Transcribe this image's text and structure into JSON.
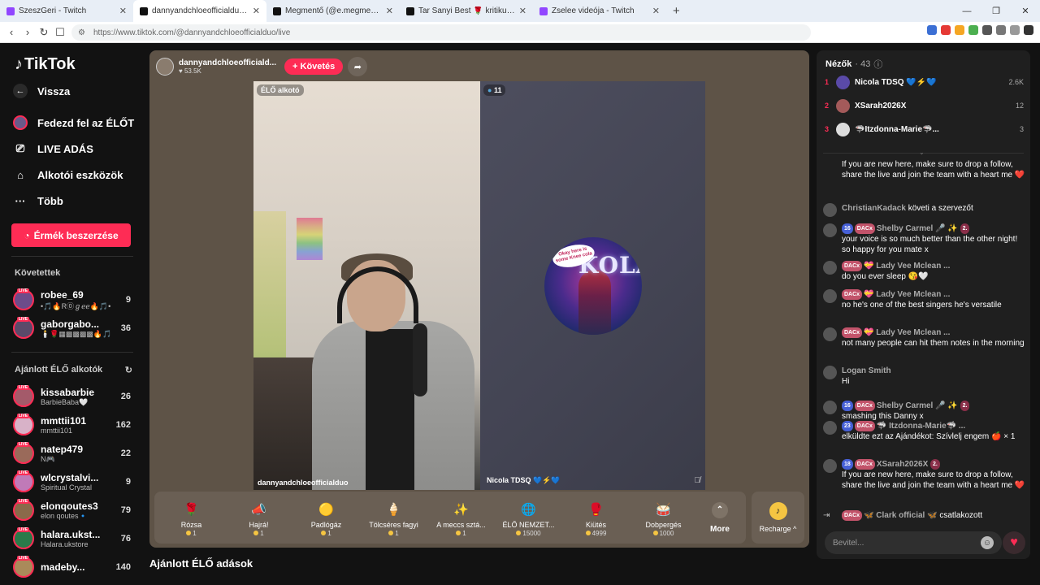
{
  "browser": {
    "tabs": [
      {
        "title": "SzeszGeri - Twitch",
        "color": "#9146ff",
        "active": false
      },
      {
        "title": "dannyandchloeofficialduo (@dan",
        "color": "#111111",
        "active": true
      },
      {
        "title": "Megmentő (@e.megmento) ÉLŐ adás",
        "color": "#111111",
        "active": false
      },
      {
        "title": "Tar Sanyi Best 🌹 kritikus 🧱 (@szop",
        "color": "#111111",
        "active": false
      },
      {
        "title": "Zselee videója - Twitch",
        "color": "#9146ff",
        "active": false
      }
    ],
    "url": "https://www.tiktok.com/@dannyandchloeofficialduo/live"
  },
  "sidebar": {
    "logo": "TikTok",
    "back": "Vissza",
    "nav": [
      {
        "label": "Fedezd fel az ÉLŐT",
        "icon": "avatar-icon"
      },
      {
        "label": "LIVE ADÁS",
        "icon": "camera-icon"
      },
      {
        "label": "Alkotói eszközök",
        "icon": "home-tools-icon"
      },
      {
        "label": "Több",
        "icon": "more-icon"
      }
    ],
    "buy_coins": "Érmék beszerzése",
    "following_title": "Követettek",
    "following": [
      {
        "name": "robee_69",
        "sub": "•🎵🔥R⓪ℊℯℯ🔥🎵•",
        "count": "9",
        "color": "#6d4c8a"
      },
      {
        "name": "gaborgabo...",
        "sub": "🕯️🌹▦▩▩▩▩🔥🎵",
        "count": "36",
        "color": "#5b4a6a"
      }
    ],
    "recommended_title": "Ajánlott ÉLŐ alkotók",
    "recommended": [
      {
        "name": "kissabarbie",
        "sub": "BarbieBaba🤍",
        "count": "26",
        "color": "#a45a6a"
      },
      {
        "name": "mmttii101",
        "sub": "mmttii101",
        "count": "162",
        "color": "#d8b2c8"
      },
      {
        "name": "natep479",
        "sub": "N🎮",
        "count": "22",
        "color": "#9a6a5a"
      },
      {
        "name": "wlcrystalvi...",
        "sub": "Spiritual Crystal",
        "count": "9",
        "color": "#c07ab8"
      },
      {
        "name": "elonqoutes3",
        "sub": "elon qoutes🔹",
        "count": "79",
        "color": "#8a6a4a"
      },
      {
        "name": "halara.ukst...",
        "sub": "Halara.ukstore",
        "count": "76",
        "color": "#2a7a4a"
      },
      {
        "name": "madeby...",
        "sub": "",
        "count": "140",
        "color": "#aa8a5a"
      }
    ]
  },
  "stream": {
    "host_name": "dannyandchloeofficiald...",
    "likes": "53.5K",
    "follow": "+ Követés",
    "left_label": "ÉLŐ alkotó",
    "right_count": "11",
    "left_name": "dannyandchloeofficialduo",
    "right_name": "Nicola TDSQ 💙⚡💙",
    "bubble": "Okay here is some Knee cola",
    "cola": "KOLA",
    "gifts": [
      {
        "name": "Rózsa",
        "price": "1",
        "icon": "🌹",
        "bg": "#6a5f54"
      },
      {
        "name": "Hajrá!",
        "price": "1",
        "icon": "📣",
        "bg": "#6a5f54"
      },
      {
        "name": "Padlógáz",
        "price": "1",
        "icon": "🟡",
        "bg": "#6a5f54"
      },
      {
        "name": "Tölcséres fagyi",
        "price": "1",
        "icon": "🍦",
        "bg": "#6a5f54"
      },
      {
        "name": "A meccs sztá...",
        "price": "1",
        "icon": "✨",
        "bg": "#6a5f54"
      },
      {
        "name": "ÉLŐ NEMZET...",
        "price": "15000",
        "icon": "🌐",
        "bg": "#6a5f54"
      },
      {
        "name": "Kiütés",
        "price": "4999",
        "icon": "🥊",
        "bg": "#6a5f54"
      },
      {
        "name": "Dobpergés",
        "price": "1000",
        "icon": "🥁",
        "bg": "#6a5f54"
      }
    ],
    "more": "More",
    "recharge": "Recharge ^",
    "recommended_title": "Ajánlott ÉLŐ adások"
  },
  "chat": {
    "viewers_title": "Nézők",
    "viewers_count": "· 43",
    "viewers": [
      {
        "rank": "1",
        "name": "Nicola TDSQ 💙⚡💙",
        "score": "2.6K",
        "color": "#5a4aa8"
      },
      {
        "rank": "2",
        "name": "XSarah2026X",
        "score": "12",
        "color": "#a45a5a"
      },
      {
        "rank": "3",
        "name": "🦈Itzdonna-Marie🦈...",
        "score": "3",
        "color": "#dddddd"
      }
    ],
    "messages": [
      {
        "text": "If you are new here, make sure to drop a follow, share the live and join the team with a heart me ❤️"
      },
      {
        "user": "ChristianKadack",
        "text": "követi a szervezőt"
      },
      {
        "lv": "16",
        "fan": "DACx",
        "user": "Shelby Carmel 🎤 ✨",
        "pk": "2.",
        "text": "your voice is so much better than the other night! so happy for you mate x"
      },
      {
        "fan": "DACx",
        "user": "💝 Lady Vee Mclean ...",
        "text": "do you ever sleep 😘🤍"
      },
      {
        "fan": "DACx",
        "user": "💝 Lady Vee Mclean ...",
        "text": "no he's one of the best singers he's versatile"
      },
      {
        "fan": "DACx",
        "user": "💝 Lady Vee Mclean ...",
        "text": "not many people can hit them notes in the morning"
      },
      {
        "user": "Logan Smith",
        "text": "Hi"
      },
      {
        "lv": "16",
        "fan": "DACx",
        "user": "Shelby Carmel 🎤 ✨",
        "pk": "2.",
        "text": "smashing this Danny x"
      },
      {
        "lv": "23",
        "fan": "DACx",
        "user": "🦈 Itzdonna-Marie🦈 ...",
        "text": "elküldte ezt az Ajándékot: Szívlelj engem 🍎 × 1"
      },
      {
        "lv": "18",
        "fan": "DACx",
        "user": "XSarah2026X",
        "pk": "2.",
        "text": "If you are new here, make sure to drop a follow, share the live and join the team with a heart me ❤️"
      },
      {
        "fan": "DACx",
        "user": "🦋 Clark official 🦋",
        "text": "csatlakozott"
      }
    ],
    "input_placeholder": "Bevitel..."
  }
}
